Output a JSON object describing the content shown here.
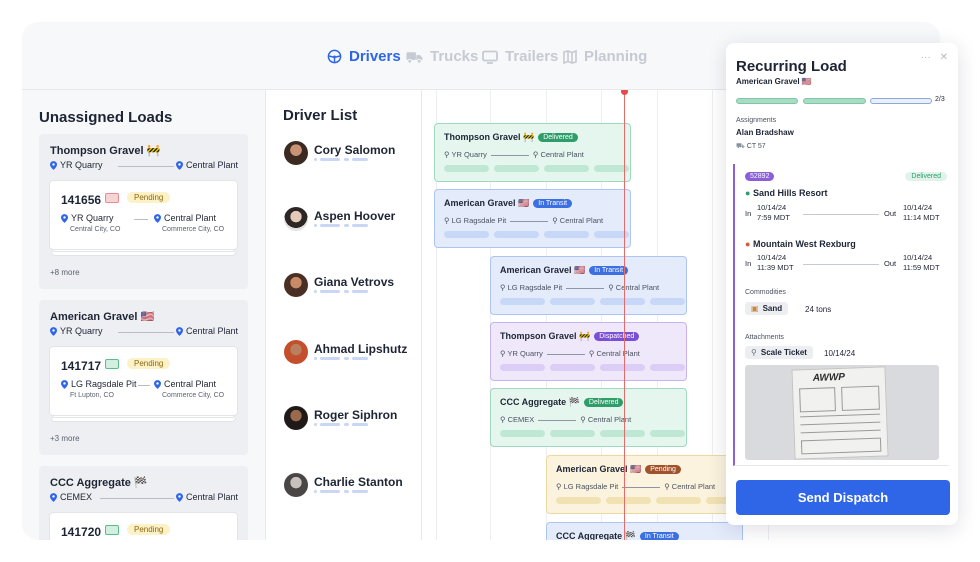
{
  "nav": {
    "tabs": [
      {
        "label": "Drivers",
        "icon": "steering-wheel-icon"
      },
      {
        "label": "Trucks",
        "icon": "truck-icon"
      },
      {
        "label": "Trailers",
        "icon": "trailer-icon"
      },
      {
        "label": "Planning",
        "icon": "map-icon"
      }
    ],
    "active_color": "#2f66e8"
  },
  "unassigned": {
    "title": "Unassigned Loads",
    "groups": [
      {
        "title": "Thompson Gravel 🚧",
        "from": "YR Quarry",
        "to": "Central Plant",
        "card": {
          "id": "141656",
          "status": "Pending",
          "from": "YR Quarry",
          "from_sub": "Central City, CO",
          "to": "Central Plant",
          "to_sub": "Commerce City, CO"
        },
        "more": "+8 more"
      },
      {
        "title": "American Gravel 🇺🇸",
        "from": "YR Quarry",
        "to": "Central Plant",
        "card": {
          "id": "141717",
          "status": "Pending",
          "from": "LG Ragsdale Pit",
          "from_sub": "Ft Lupton, CO",
          "to": "Central Plant",
          "to_sub": "Commerce City, CO"
        },
        "more": "+3 more"
      },
      {
        "title": "CCC Aggregate 🏁",
        "from": "CEMEX",
        "to": "Central Plant",
        "card": {
          "id": "141720",
          "status": "Pending"
        }
      }
    ]
  },
  "drivers": {
    "title": "Driver List",
    "items": [
      {
        "name": "Cory Salomon"
      },
      {
        "name": "Aspen Hoover"
      },
      {
        "name": "Giana Vetrovs"
      },
      {
        "name": "Ahmad Lipshutz"
      },
      {
        "name": "Roger Siphron"
      },
      {
        "name": "Charlie Stanton"
      }
    ]
  },
  "timeline": {
    "blocks": [
      {
        "title": "Thompson Gravel 🚧",
        "status": "Delivered",
        "from": "YR Quarry",
        "to": "Central Plant"
      },
      {
        "title": "American Gravel 🇺🇸",
        "status": "In Transit",
        "from": "LG Ragsdale Pit",
        "to": "Central Plant"
      },
      {
        "title": "American Gravel 🇺🇸",
        "status": "In Transit",
        "from": "LG Ragsdale Pit",
        "to": "Central Plant"
      },
      {
        "title": "Thompson Gravel 🚧",
        "status": "Dispatched",
        "from": "YR Quarry",
        "to": "Central Plant"
      },
      {
        "title": "CCC Aggregate 🏁",
        "status": "Delivered",
        "from": "CEMEX",
        "to": "Central Plant"
      },
      {
        "title": "American Gravel 🇺🇸",
        "status": "Pending",
        "from": "LG Ragsdale Pit",
        "to": "Central Plant"
      },
      {
        "title": "CCC Aggregate 🏁",
        "status": "In Transit"
      }
    ]
  },
  "detail": {
    "title": "Recurring Load",
    "subtitle": "American Gravel 🇺🇸",
    "menu_icon": "···",
    "close_icon": "✕",
    "progress": {
      "completed": 2,
      "total": 3,
      "label": "2/3"
    },
    "assignments_label": "Assignments",
    "driver": "Alan Bradshaw",
    "truck": "CT 57",
    "load_id": "52892",
    "load_status": "Delivered",
    "stops": [
      {
        "name": "Sand Hills Resort",
        "in_label": "In",
        "in_date": "10/14/24",
        "in_time": "7:59 MDT",
        "out_label": "Out",
        "out_date": "10/14/24",
        "out_time": "11:14 MDT"
      },
      {
        "name": "Mountain West Rexburg",
        "in_label": "In",
        "in_date": "10/14/24",
        "in_time": "11:39 MDT",
        "out_label": "Out",
        "out_date": "10/14/24",
        "out_time": "11:59 MDT"
      }
    ],
    "commodities_label": "Commodities",
    "commodity": "Sand",
    "commodity_amount": "24 tons",
    "attachments_label": "Attachments",
    "attachment": "Scale Ticket",
    "attachment_date": "10/14/24",
    "ticket_logo": "AWWP",
    "send_label": "Send Dispatch"
  },
  "colors": {
    "delivered_bg": "#e5f6ef",
    "delivered_border": "#9fd8bd",
    "delivered_badge": "#2f9d6a",
    "transit_bg": "#e4ecfc",
    "transit_border": "#aec4f2",
    "transit_badge": "#3b6fe2",
    "dispatched_bg": "#efe8fb",
    "dispatched_border": "#c7b3ee",
    "dispatched_badge": "#7a4fd6",
    "pending_bg": "#fbf3dd",
    "pending_border": "#ecd9a0",
    "pending_badge": "#a0522d",
    "now_line": "#e56b6b"
  }
}
